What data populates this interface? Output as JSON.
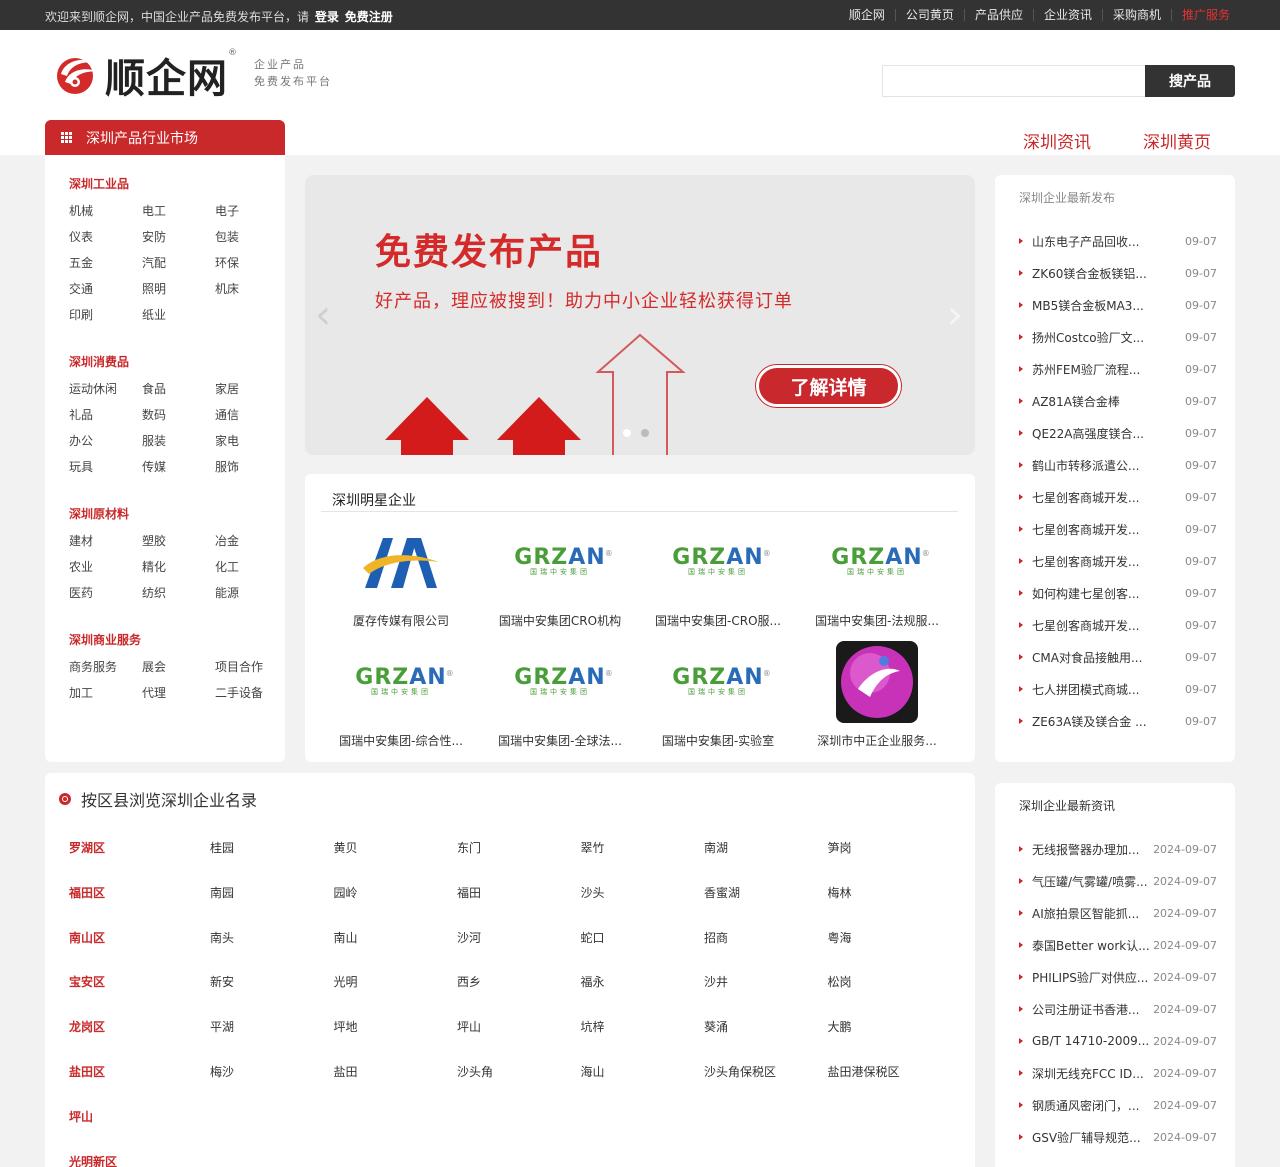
{
  "topbar": {
    "welcome": "欢迎来到顺企网，中国企业产品免费发布平台，请",
    "login": "登录",
    "register": "免费注册",
    "nav": [
      "顺企网",
      "公司黄页",
      "产品供应",
      "企业资讯",
      "采购商机",
      "推广服务"
    ]
  },
  "header": {
    "logo_text": "顺企网",
    "logo_reg": "®",
    "slogan_1": "企业产品",
    "slogan_2": "免费发布平台",
    "search_button": "搜产品",
    "category_tab": "深圳产品行业市场",
    "link_news": "深圳资讯",
    "link_yellow": "深圳黄页"
  },
  "categories": [
    {
      "title": "深圳工业品",
      "items": [
        "机械",
        "电工",
        "电子",
        "仪表",
        "安防",
        "包装",
        "五金",
        "汽配",
        "环保",
        "交通",
        "照明",
        "机床",
        "印刷",
        "纸业"
      ]
    },
    {
      "title": "深圳消费品",
      "items": [
        "运动休闲",
        "食品",
        "家居",
        "礼品",
        "数码",
        "通信",
        "办公",
        "服装",
        "家电",
        "玩具",
        "传媒",
        "服饰"
      ]
    },
    {
      "title": "深圳原材料",
      "items": [
        "建材",
        "塑胶",
        "冶金",
        "农业",
        "精化",
        "化工",
        "医药",
        "纺织",
        "能源"
      ]
    },
    {
      "title": "深圳商业服务",
      "items": [
        "商务服务",
        "展会",
        "项目合作",
        "加工",
        "代理",
        "二手设备"
      ]
    }
  ],
  "banner": {
    "title": "免费发布产品",
    "subtitle": "好产品，理应被搜到！助力中小企业轻松获得订单",
    "cta": "了解详情"
  },
  "stars": {
    "title": "深圳明星企业",
    "companies": [
      {
        "name": "厦存传媒有限公司",
        "logo": "aa-logo"
      },
      {
        "name": "国瑞中安集团CRO机构",
        "logo": "grzan-logo"
      },
      {
        "name": "国瑞中安集团-CRO服...",
        "logo": "grzan-logo"
      },
      {
        "name": "国瑞中安集团-法规服...",
        "logo": "grzan-logo"
      },
      {
        "name": "国瑞中安集团-综合性...",
        "logo": "grzan-logo"
      },
      {
        "name": "国瑞中安集团-全球法...",
        "logo": "grzan-logo"
      },
      {
        "name": "国瑞中安集团-实验室",
        "logo": "grzan-logo"
      },
      {
        "name": "深圳市中正企业服务...",
        "logo": "globe-logo"
      }
    ],
    "grzan_text_1": "GRZ",
    "grzan_text_2": "AN",
    "grzan_sub": "国瑞中安集团"
  },
  "latest": {
    "title": "深圳企业最新发布",
    "items": [
      {
        "t": "山东电子产品回收...",
        "d": "09-07"
      },
      {
        "t": "ZK60镁合金板镁铝...",
        "d": "09-07"
      },
      {
        "t": "MB5镁合金板MA3...",
        "d": "09-07"
      },
      {
        "t": "扬州Costco验厂文...",
        "d": "09-07"
      },
      {
        "t": "苏州FEM验厂流程...",
        "d": "09-07"
      },
      {
        "t": "AZ81A镁合金棒",
        "d": "09-07"
      },
      {
        "t": "QE22A高强度镁合...",
        "d": "09-07"
      },
      {
        "t": "鹤山市转移派遣公...",
        "d": "09-07"
      },
      {
        "t": "七星创客商城开发...",
        "d": "09-07"
      },
      {
        "t": "七星创客商城开发...",
        "d": "09-07"
      },
      {
        "t": "七星创客商城开发...",
        "d": "09-07"
      },
      {
        "t": "如何构建七星创客...",
        "d": "09-07"
      },
      {
        "t": "七星创客商城开发...",
        "d": "09-07"
      },
      {
        "t": "CMA对食品接触用...",
        "d": "09-07"
      },
      {
        "t": "七人拼团模式商城...",
        "d": "09-07"
      },
      {
        "t": "ZE63A镁及镁合金 ...",
        "d": "09-07"
      }
    ]
  },
  "news": {
    "title": "深圳企业最新资讯",
    "items": [
      {
        "t": "无线报警器办理加...",
        "d": "2024-09-07"
      },
      {
        "t": "气压罐/气雾罐/喷雾...",
        "d": "2024-09-07"
      },
      {
        "t": "AI旅拍景区智能抓...",
        "d": "2024-09-07"
      },
      {
        "t": "泰国Better work认...",
        "d": "2024-09-07"
      },
      {
        "t": "PHILIPS验厂对供应...",
        "d": "2024-09-07"
      },
      {
        "t": "公司注册证书香港...",
        "d": "2024-09-07"
      },
      {
        "t": "GB/T 14710-2009...",
        "d": "2024-09-07"
      },
      {
        "t": "深圳无线充FCC ID...",
        "d": "2024-09-07"
      },
      {
        "t": "钢质通风密闭门，...",
        "d": "2024-09-07"
      },
      {
        "t": "GSV验厂辅导规范...",
        "d": "2024-09-07"
      }
    ]
  },
  "district": {
    "title": "按区县浏览深圳企业名录",
    "rows": [
      {
        "name": "罗湖区",
        "subs": [
          "桂园",
          "黄贝",
          "东门",
          "翠竹",
          "南湖",
          "笋岗"
        ]
      },
      {
        "name": "福田区",
        "subs": [
          "南园",
          "园岭",
          "福田",
          "沙头",
          "香蜜湖",
          "梅林"
        ]
      },
      {
        "name": "南山区",
        "subs": [
          "南头",
          "南山",
          "沙河",
          "蛇口",
          "招商",
          "粤海"
        ]
      },
      {
        "name": "宝安区",
        "subs": [
          "新安",
          "光明",
          "西乡",
          "福永",
          "沙井",
          "松岗"
        ]
      },
      {
        "name": "龙岗区",
        "subs": [
          "平湖",
          "坪地",
          "坪山",
          "坑梓",
          "葵涌",
          "大鹏"
        ]
      },
      {
        "name": "盐田区",
        "subs": [
          "梅沙",
          "盐田",
          "沙头角",
          "海山",
          "沙头角保税区",
          "盐田港保税区"
        ]
      },
      {
        "name": "坪山",
        "subs": []
      },
      {
        "name": "光明新区",
        "subs": []
      }
    ]
  },
  "colors": {
    "brand_red": "#c9292a",
    "topbar": "#333333",
    "search_btn": "#333333"
  }
}
